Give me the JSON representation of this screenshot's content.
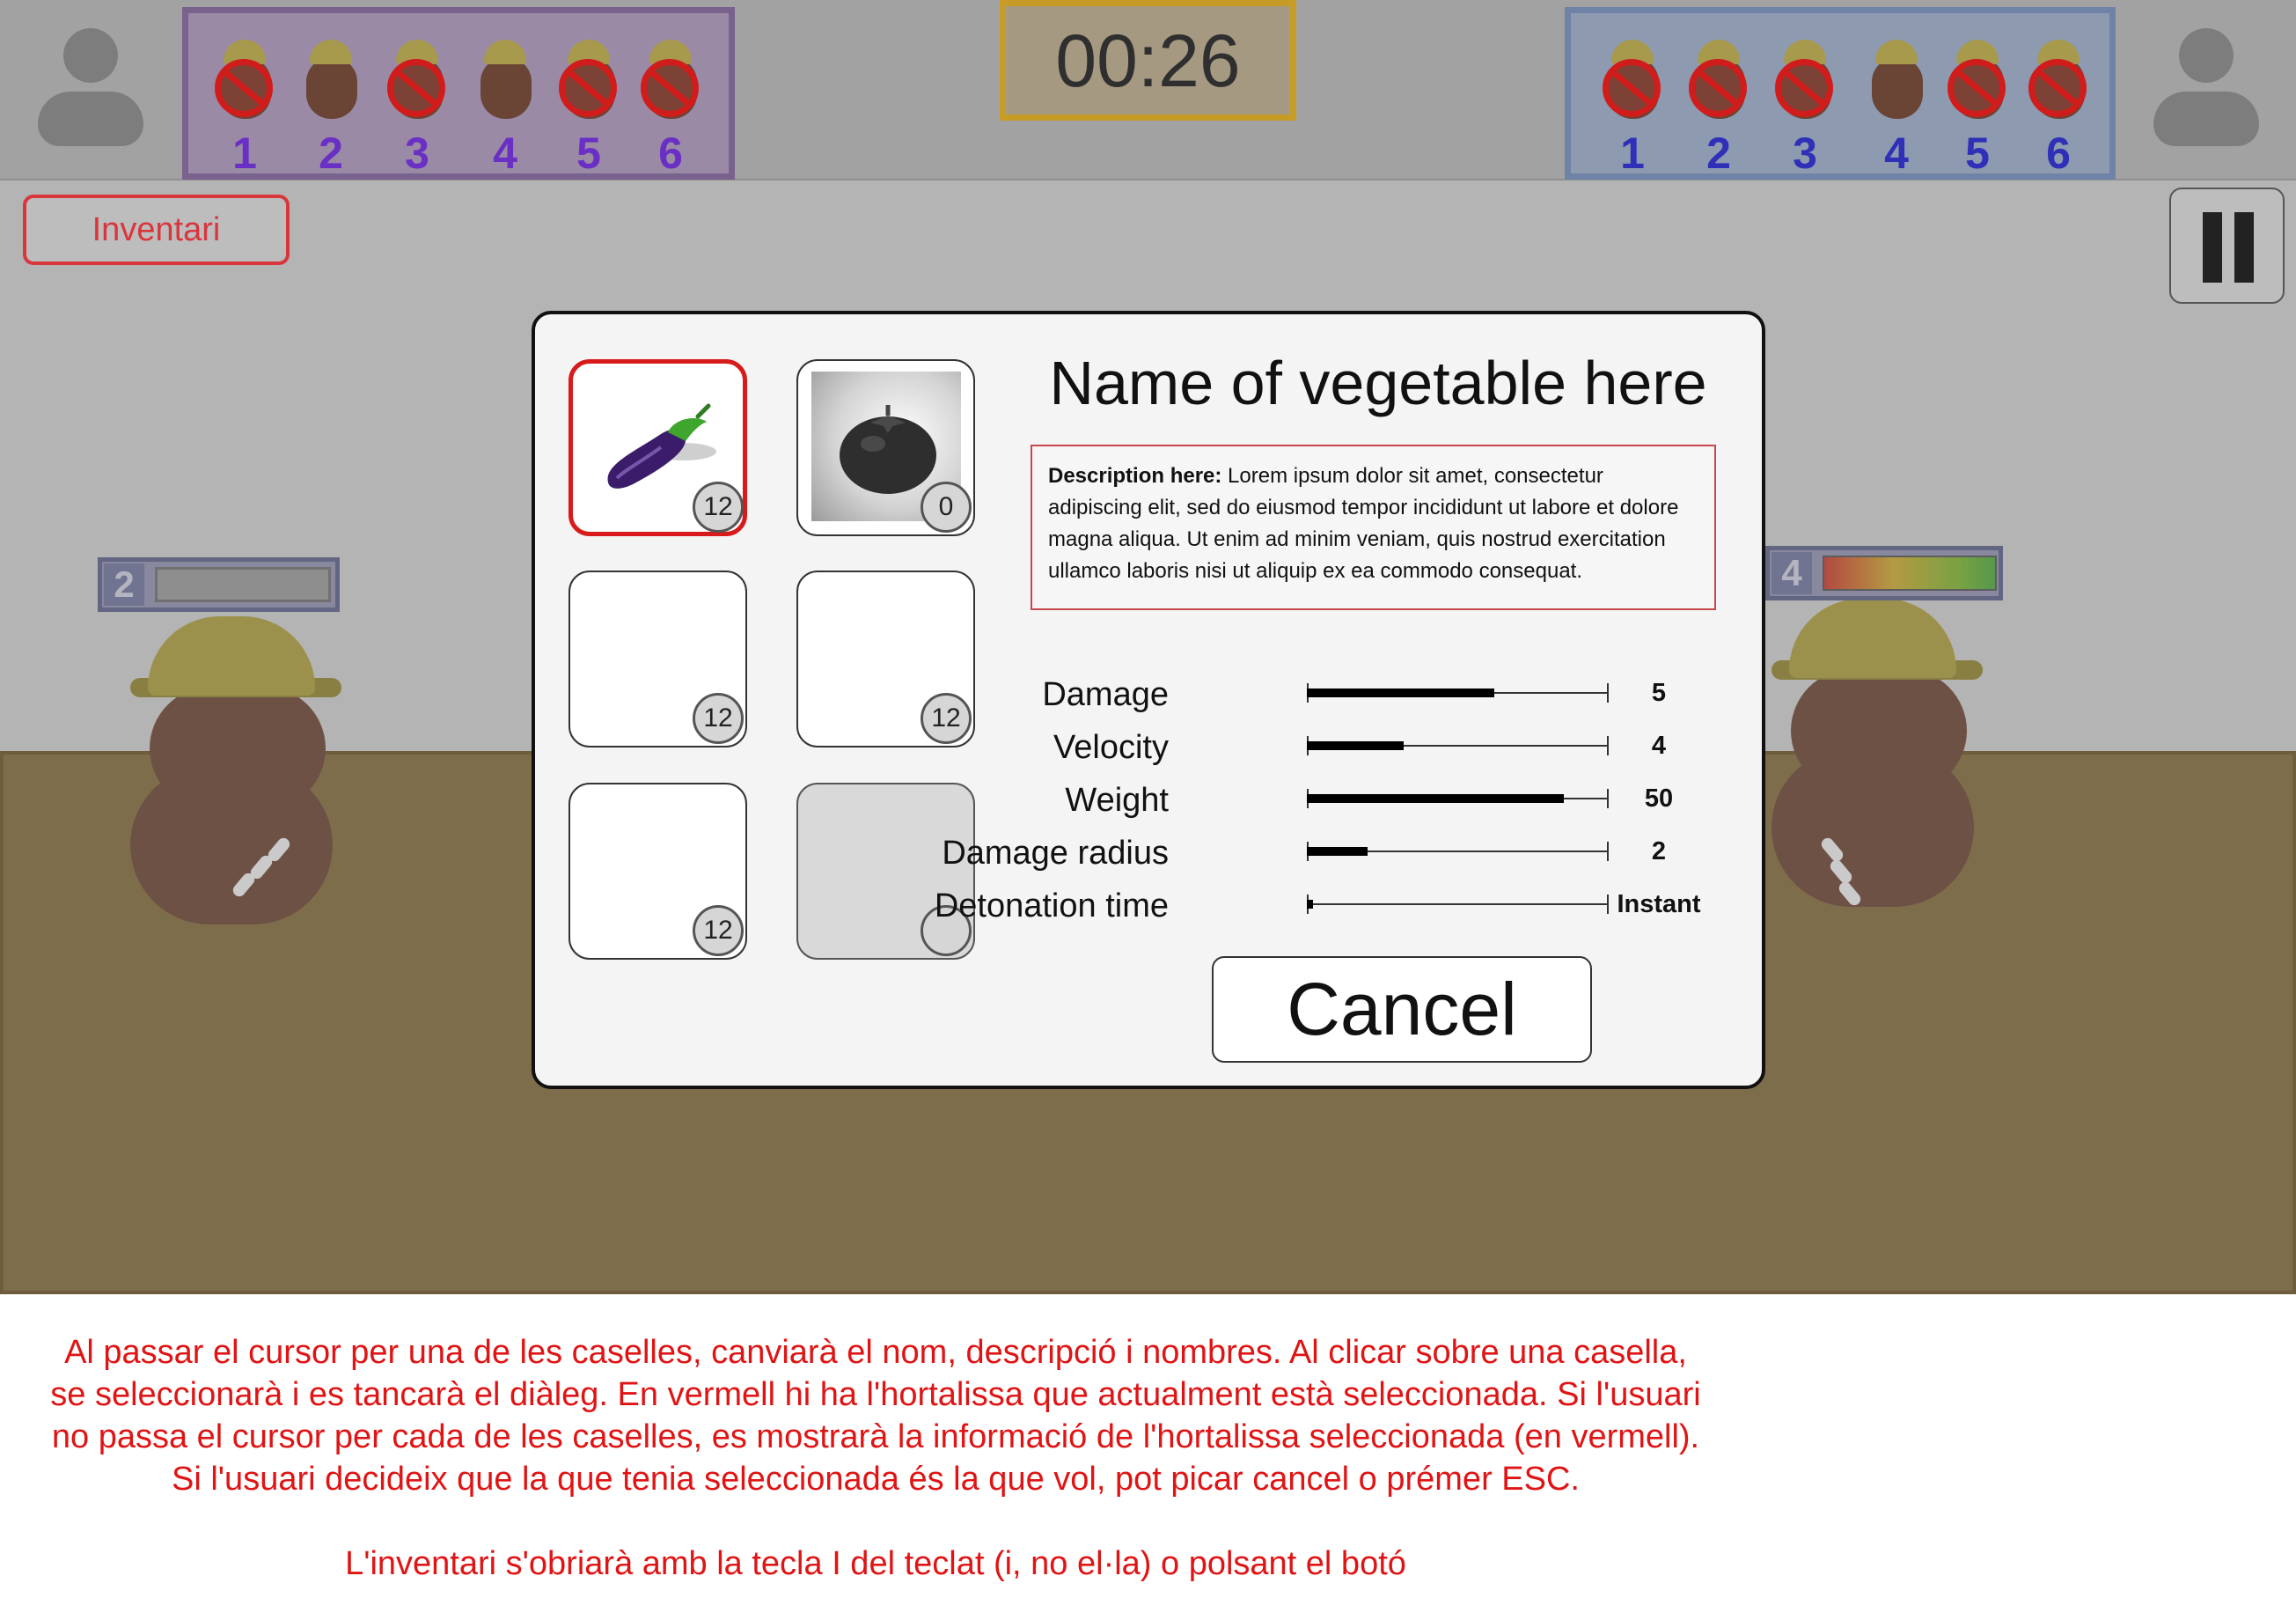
{
  "game": {
    "timer": "00:26",
    "inventory_button_label": "Inventari",
    "left_team": {
      "slots": [
        {
          "num": "1",
          "banned": true
        },
        {
          "num": "2",
          "banned": false
        },
        {
          "num": "3",
          "banned": true
        },
        {
          "num": "4",
          "banned": false
        },
        {
          "num": "5",
          "banned": true
        },
        {
          "num": "6",
          "banned": true
        }
      ],
      "color": "#79628e"
    },
    "right_team": {
      "slots": [
        {
          "num": "1",
          "banned": true
        },
        {
          "num": "2",
          "banned": true
        },
        {
          "num": "3",
          "banned": true
        },
        {
          "num": "4",
          "banned": false
        },
        {
          "num": "5",
          "banned": true
        },
        {
          "num": "6",
          "banned": true
        }
      ],
      "color": "#6f83a6"
    },
    "left_player": {
      "level": "2",
      "health_fraction": 0.0
    },
    "right_player": {
      "level": "4",
      "health_fraction": 1.0
    }
  },
  "dialog": {
    "title": "Name of vegetable here",
    "description_label": "Description here:",
    "description_text": " Lorem ipsum dolor sit amet, consectetur adipiscing elit, sed do eiusmod tempor incididunt ut labore et dolore magna aliqua. Ut enim ad minim veniam, quis nostrud exercitation ullamco laboris nisi ut aliquip ex ea commodo consequat.",
    "items": [
      {
        "icon": "eggplant-icon",
        "count": "12",
        "selected": true,
        "disabled": false
      },
      {
        "icon": "tomato-icon",
        "count": "0",
        "selected": false,
        "disabled": false
      },
      {
        "icon": "",
        "count": "12",
        "selected": false,
        "disabled": false
      },
      {
        "icon": "",
        "count": "12",
        "selected": false,
        "disabled": false
      },
      {
        "icon": "",
        "count": "12",
        "selected": false,
        "disabled": false
      },
      {
        "icon": "",
        "count": "",
        "selected": false,
        "disabled": true
      }
    ],
    "stats": [
      {
        "label": "Damage",
        "value": "5",
        "fill_fraction": 0.62
      },
      {
        "label": "Velocity",
        "value": "4",
        "fill_fraction": 0.32
      },
      {
        "label": "Weight",
        "value": "50",
        "fill_fraction": 0.85
      },
      {
        "label": "Damage radius",
        "value": "2",
        "fill_fraction": 0.2
      },
      {
        "label": "Detonation time",
        "value": "Instant",
        "fill_fraction": 0.02
      }
    ],
    "cancel_label": "Cancel",
    "selected_color": "#d81a1a"
  },
  "caption": {
    "line1": "Al passar el cursor per una de les caselles, canviarà el nom, descripció i nombres. Al clicar sobre una casella,",
    "line2": "se seleccionarà i es tancarà el diàleg. En vermell hi ha l'hortalissa que actualment està seleccionada. Si l'usuari",
    "line3": "no passa el cursor per cada de les caselles, es mostrarà la informació de l'hortalissa seleccionada (en vermell).",
    "line4": "Si l'usuari decideix que la que tenia seleccionada és la que vol, pot picar cancel o prémer ESC.",
    "line5": "L'inventari s'obriarà amb la tecla I del teclat (i, no el·la) o polsant el botó",
    "color": "#e01414"
  }
}
